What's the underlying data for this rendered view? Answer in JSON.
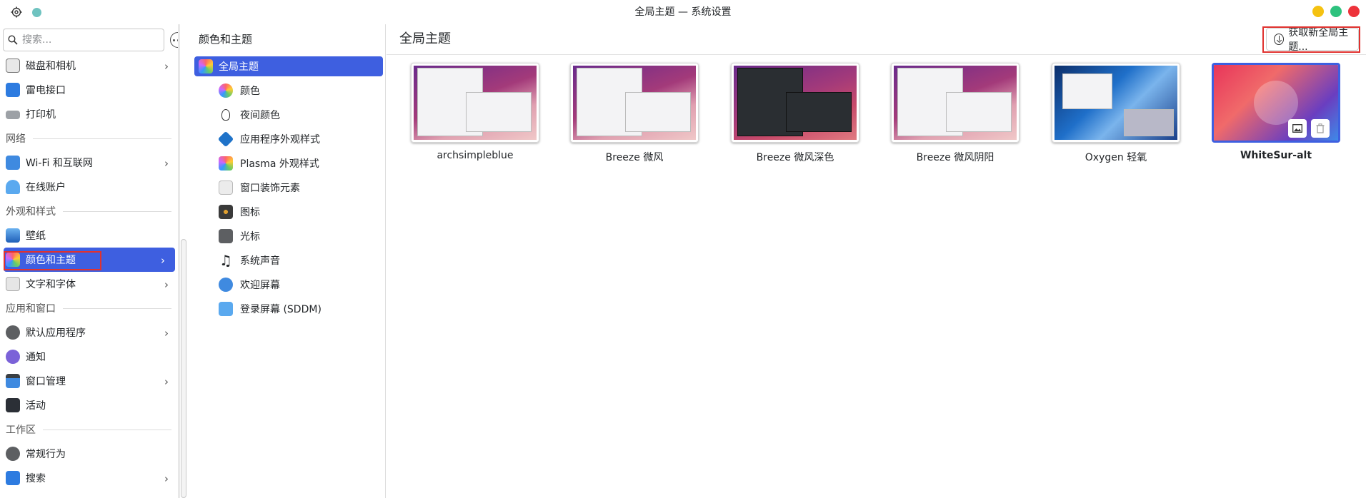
{
  "window": {
    "title": "全局主题 — 系统设置",
    "controls": {
      "minimize_color": "#f5c211",
      "maximize_color": "#2ec27e",
      "close_color": "#ed333b"
    }
  },
  "sidebar": {
    "search_placeholder": "搜索...",
    "items": [
      {
        "label": "磁盘和相机",
        "chevron": true,
        "icon": "disk-camera-icon"
      },
      {
        "label": "雷电接口",
        "chevron": false,
        "icon": "thunderbolt-icon"
      },
      {
        "label": "打印机",
        "chevron": false,
        "icon": "printer-icon"
      }
    ],
    "section_network": "网络",
    "network_items": [
      {
        "label": "Wi-Fi 和互联网",
        "chevron": true,
        "icon": "wifi-icon"
      },
      {
        "label": "在线账户",
        "chevron": false,
        "icon": "online-accounts-icon"
      }
    ],
    "section_appearance": "外观和样式",
    "appearance_items": [
      {
        "label": "壁纸",
        "chevron": false,
        "icon": "wallpaper-icon"
      },
      {
        "label": "颜色和主题",
        "chevron": true,
        "icon": "colors-themes-icon",
        "active": true
      },
      {
        "label": "文字和字体",
        "chevron": true,
        "icon": "fonts-icon"
      }
    ],
    "section_apps": "应用和窗口",
    "apps_items": [
      {
        "label": "默认应用程序",
        "chevron": true,
        "icon": "default-apps-icon"
      },
      {
        "label": "通知",
        "chevron": false,
        "icon": "notifications-icon"
      },
      {
        "label": "窗口管理",
        "chevron": true,
        "icon": "window-management-icon"
      },
      {
        "label": "活动",
        "chevron": false,
        "icon": "activities-icon"
      }
    ],
    "section_workspace": "工作区",
    "workspace_items": [
      {
        "label": "常规行为",
        "chevron": false,
        "icon": "general-behavior-icon"
      },
      {
        "label": "搜索",
        "chevron": true,
        "icon": "search-settings-icon"
      }
    ]
  },
  "middle": {
    "title": "颜色和主题",
    "items": [
      {
        "label": "全局主题",
        "icon": "global-theme-icon",
        "active": true
      },
      {
        "label": "颜色",
        "icon": "colors-icon"
      },
      {
        "label": "夜间颜色",
        "icon": "night-color-icon"
      },
      {
        "label": "应用程序外观样式",
        "icon": "app-style-icon"
      },
      {
        "label": "Plasma 外观样式",
        "icon": "plasma-style-icon"
      },
      {
        "label": "窗口装饰元素",
        "icon": "window-decorations-icon"
      },
      {
        "label": "图标",
        "icon": "icons-icon"
      },
      {
        "label": "光标",
        "icon": "cursors-icon"
      },
      {
        "label": "系统声音",
        "icon": "system-sounds-icon"
      },
      {
        "label": "欢迎屏幕",
        "icon": "splash-screen-icon"
      },
      {
        "label": "登录屏幕 (SDDM)",
        "icon": "login-screen-icon"
      }
    ]
  },
  "main": {
    "title": "全局主题",
    "get_new_label": "获取新全局主题...",
    "themes": [
      {
        "name": "archsimpleblue",
        "style": "light",
        "selected": false
      },
      {
        "name": "Breeze 微风",
        "style": "light",
        "selected": false
      },
      {
        "name": "Breeze 微风深色",
        "style": "dark",
        "selected": false
      },
      {
        "name": "Breeze 微风阴阳",
        "style": "twilight",
        "selected": false
      },
      {
        "name": "Oxygen 轻氧",
        "style": "oxygen",
        "selected": false
      },
      {
        "name": "WhiteSur-alt",
        "style": "whitesur",
        "selected": true
      }
    ]
  },
  "colors": {
    "accent": "#3e5fe0",
    "highlight_box": "#e0322f"
  }
}
